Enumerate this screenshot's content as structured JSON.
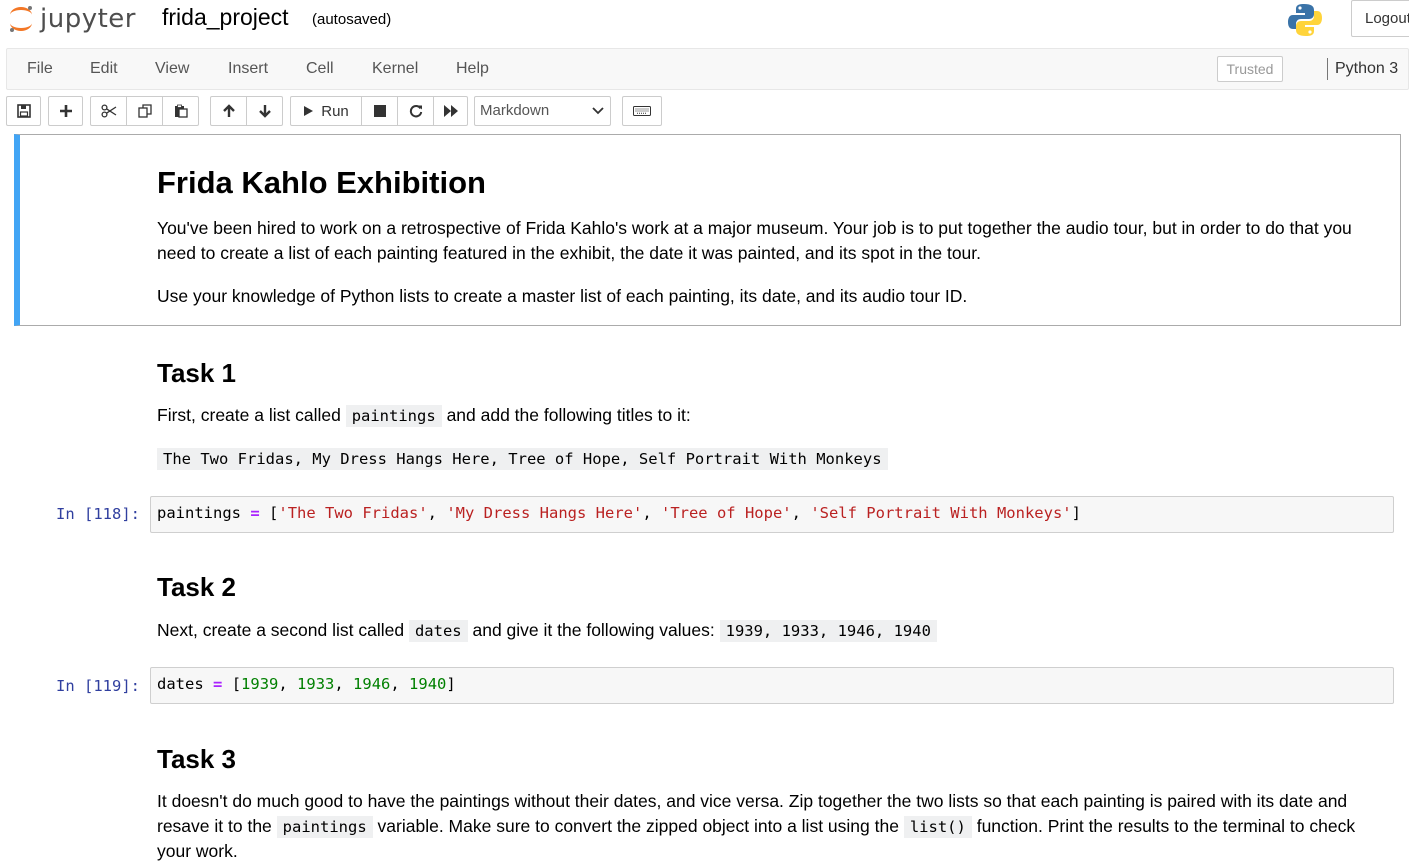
{
  "header": {
    "logo_text": "jupyter",
    "notebook_name": "frida_project",
    "autosave_status": "(autosaved)",
    "logout_label": "Logout"
  },
  "menubar": {
    "items": [
      "File",
      "Edit",
      "View",
      "Insert",
      "Cell",
      "Kernel",
      "Help"
    ],
    "trusted_label": "Trusted",
    "kernel_name": "Python 3"
  },
  "toolbar": {
    "run_label": "Run",
    "cell_type": "Markdown",
    "icons": [
      "save-icon",
      "plus-icon",
      "scissors-icon",
      "copy-icon",
      "paste-icon",
      "arrow-up-icon",
      "arrow-down-icon",
      "play-icon",
      "stop-icon",
      "restart-icon",
      "fast-forward-icon",
      "keyboard-icon"
    ]
  },
  "cells": {
    "intro": {
      "title": "Frida Kahlo Exhibition",
      "para1_line1": "You've been hired to work on a retrospective of Frida Kahlo's work at a major museum. Your job is to put together the audio tour, but in order to do that you",
      "para1_line2": "need to create a list of each painting featured in the exhibit, the date it was painted, and its spot in the tour.",
      "para2": "Use your knowledge of Python lists to create a master list of each painting, its date, and its audio tour ID."
    },
    "task1": {
      "heading": "Task 1",
      "text_before": "First, create a list called",
      "code_inline": "paintings",
      "text_after": "and add the following titles to it:",
      "titles_code": "The Two Fridas, My Dress Hangs Here, Tree of Hope, Self Portrait With Monkeys"
    },
    "code1": {
      "prompt": "In [118]:",
      "var": "paintings",
      "op": "=",
      "strings": [
        "'The Two Fridas'",
        "'My Dress Hangs Here'",
        "'Tree of Hope'",
        "'Self Portrait With Monkeys'"
      ]
    },
    "task2": {
      "heading": "Task 2",
      "text_before": "Next, create a second list called",
      "code_inline": "dates",
      "text_after": "and give it the following values:",
      "values_code": "1939, 1933, 1946, 1940"
    },
    "code2": {
      "prompt": "In [119]:",
      "var": "dates",
      "op": "=",
      "numbers": [
        "1939",
        "1933",
        "1946",
        "1940"
      ]
    },
    "task3": {
      "heading": "Task 3",
      "line1": "It doesn't do much good to have the paintings without their dates, and vice versa. Zip together the two lists so that each painting is paired with its date and",
      "line2_before": "resave it to the",
      "line2_code1": "paintings",
      "line2_mid": "variable. Make sure to convert the zipped object into a list using the",
      "line2_code2": "list()",
      "line2_after": "function. Print the results to the terminal to check",
      "line3": "your work."
    }
  }
}
